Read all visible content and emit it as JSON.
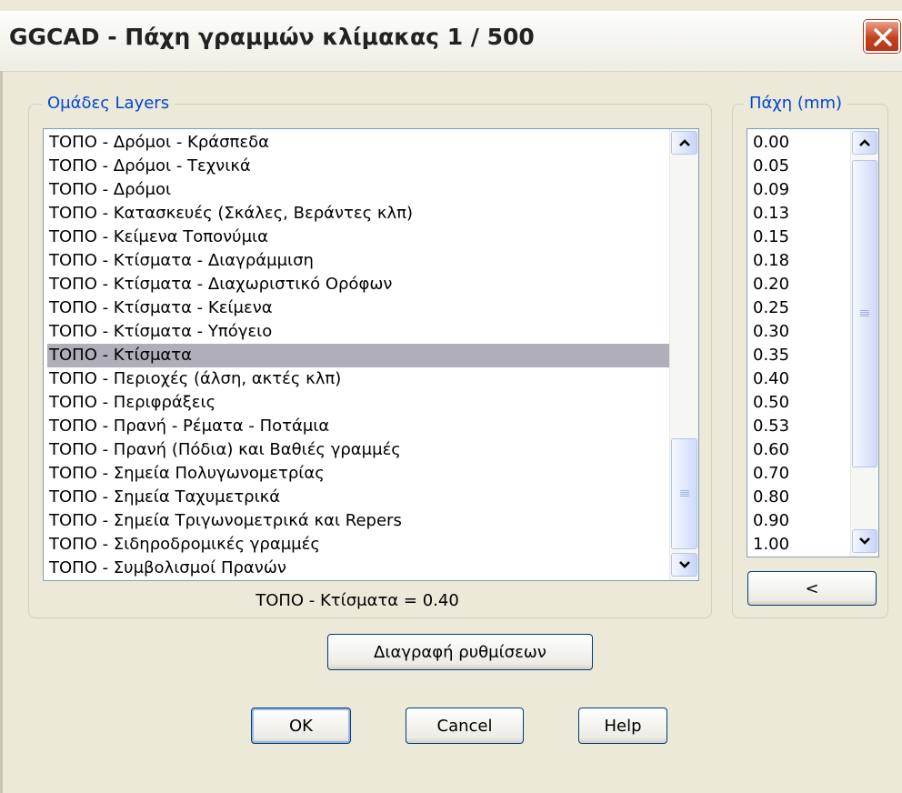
{
  "window": {
    "title": "GGCAD - Πάχη γραμμών κλίμακας 1 / 500"
  },
  "layers_group": {
    "legend": "Ομάδες Layers",
    "items": [
      "ΤΟΠΟ - Δρόμοι - Κράσπεδα",
      "ΤΟΠΟ - Δρόμοι - Τεχνικά",
      "ΤΟΠΟ - Δρόμοι",
      "ΤΟΠΟ - Κατασκευές (Σκάλες, Βεράντες κλπ)",
      "ΤΟΠΟ - Κείμενα Τοπονύμια",
      "ΤΟΠΟ - Κτίσματα - Διαγράμμιση",
      "ΤΟΠΟ - Κτίσματα - Διαχωριστικό Ορόφων",
      "ΤΟΠΟ - Κτίσματα - Κείμενα",
      "ΤΟΠΟ - Κτίσματα - Υπόγειο",
      "ΤΟΠΟ - Κτίσματα",
      "ΤΟΠΟ - Περιοχές (άλση, ακτές κλπ)",
      "ΤΟΠΟ - Περιφράξεις",
      "ΤΟΠΟ - Πρανή - Ρέματα - Ποτάμια",
      "ΤΟΠΟ - Πρανή (Πόδια) και Βαθιές γραμμές",
      "ΤΟΠΟ - Σημεία Πολυγωνομετρίας",
      "ΤΟΠΟ - Σημεία Ταχυμετρικά",
      "ΤΟΠΟ - Σημεία Τριγωνομετρικά και Repers",
      "ΤΟΠΟ - Σιδηροδρομικές γραμμές",
      "ΤΟΠΟ - Συμβολισμοί Πρανών"
    ],
    "selected": "ΤΟΠΟ - Κτίσματα",
    "status_text": "ΤΟΠΟ - Κτίσματα = 0.40"
  },
  "thickness_group": {
    "legend": "Πάχη (mm)",
    "items": [
      "0.00",
      "0.05",
      "0.09",
      "0.13",
      "0.15",
      "0.18",
      "0.20",
      "0.25",
      "0.30",
      "0.35",
      "0.40",
      "0.50",
      "0.53",
      "0.60",
      "0.70",
      "0.80",
      "0.90",
      "1.00"
    ],
    "assign_button_label": "<"
  },
  "buttons": {
    "delete_settings": "Διαγραφή ρυθμίσεων",
    "ok": "OK",
    "cancel": "Cancel",
    "help": "Help"
  }
}
